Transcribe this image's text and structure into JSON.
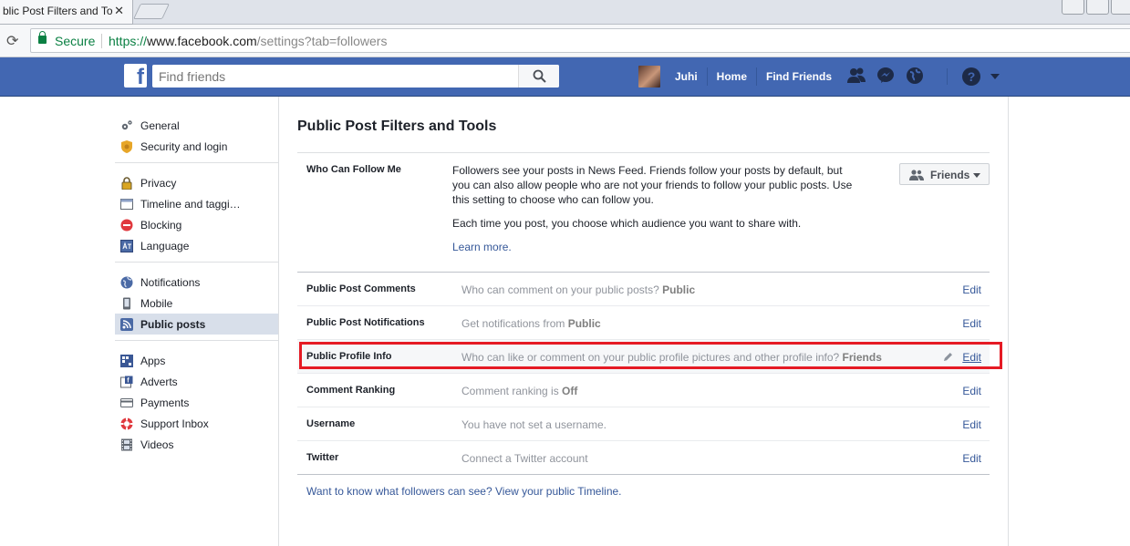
{
  "browser": {
    "tab_title": "blic Post Filters and To",
    "close_glyph": "✕",
    "reload_glyph": "⟳",
    "secure_label": "Secure",
    "url_scheme": "https://",
    "url_host": "www.facebook.com",
    "url_path": "/settings?tab=followers"
  },
  "header": {
    "logo": "f",
    "search_placeholder": "Find friends",
    "user_name": "Juhi",
    "home_label": "Home",
    "find_friends_label": "Find Friends",
    "help_glyph": "?",
    "color_bar": "#4267b2"
  },
  "sidebar": {
    "groups": [
      [
        {
          "label": "General",
          "icon": "gears-icon"
        },
        {
          "label": "Security and login",
          "icon": "badge-icon"
        }
      ],
      [
        {
          "label": "Privacy",
          "icon": "lock-icon"
        },
        {
          "label": "Timeline and taggi…",
          "icon": "timeline-icon"
        },
        {
          "label": "Blocking",
          "icon": "block-icon"
        },
        {
          "label": "Language",
          "icon": "language-icon"
        }
      ],
      [
        {
          "label": "Notifications",
          "icon": "globe-icon"
        },
        {
          "label": "Mobile",
          "icon": "mobile-icon"
        },
        {
          "label": "Public posts",
          "icon": "rss-icon",
          "active": true
        }
      ],
      [
        {
          "label": "Apps",
          "icon": "apps-icon"
        },
        {
          "label": "Adverts",
          "icon": "adverts-icon"
        },
        {
          "label": "Payments",
          "icon": "card-icon"
        },
        {
          "label": "Support Inbox",
          "icon": "lifebuoy-icon"
        },
        {
          "label": "Videos",
          "icon": "film-icon"
        }
      ]
    ]
  },
  "main": {
    "title": "Public Post Filters and Tools",
    "follow": {
      "label": "Who Can Follow Me",
      "para1": "Followers see your posts in News Feed. Friends follow your posts by default, but you can also allow people who are not your friends to follow your public posts. Use this setting to choose who can follow you.",
      "para2": "Each time you post, you choose which audience you want to share with.",
      "learn_more": "Learn more.",
      "audience_button": "Friends"
    },
    "rows": [
      {
        "label": "Public Post Comments",
        "desc": "Who can comment on your public posts? ",
        "value": "Public",
        "edit": "Edit"
      },
      {
        "label": "Public Post Notifications",
        "desc": "Get notifications from ",
        "value": "Public",
        "edit": "Edit"
      },
      {
        "label": "Public Profile Info",
        "desc": "Who can like or comment on your public profile pictures and other profile info? ",
        "value": "Friends",
        "edit": "Edit",
        "highlighted": true
      },
      {
        "label": "Comment Ranking",
        "desc": "Comment ranking is ",
        "value": "Off",
        "edit": "Edit"
      },
      {
        "label": "Username",
        "desc": "You have not set a username.",
        "value": "",
        "edit": "Edit"
      },
      {
        "label": "Twitter",
        "desc": "Connect a Twitter account",
        "value": "",
        "edit": "Edit"
      }
    ],
    "footer": "Want to know what followers can see? View your public Timeline."
  },
  "colors": {
    "highlight_border": "#e51a24",
    "link": "#365899"
  }
}
